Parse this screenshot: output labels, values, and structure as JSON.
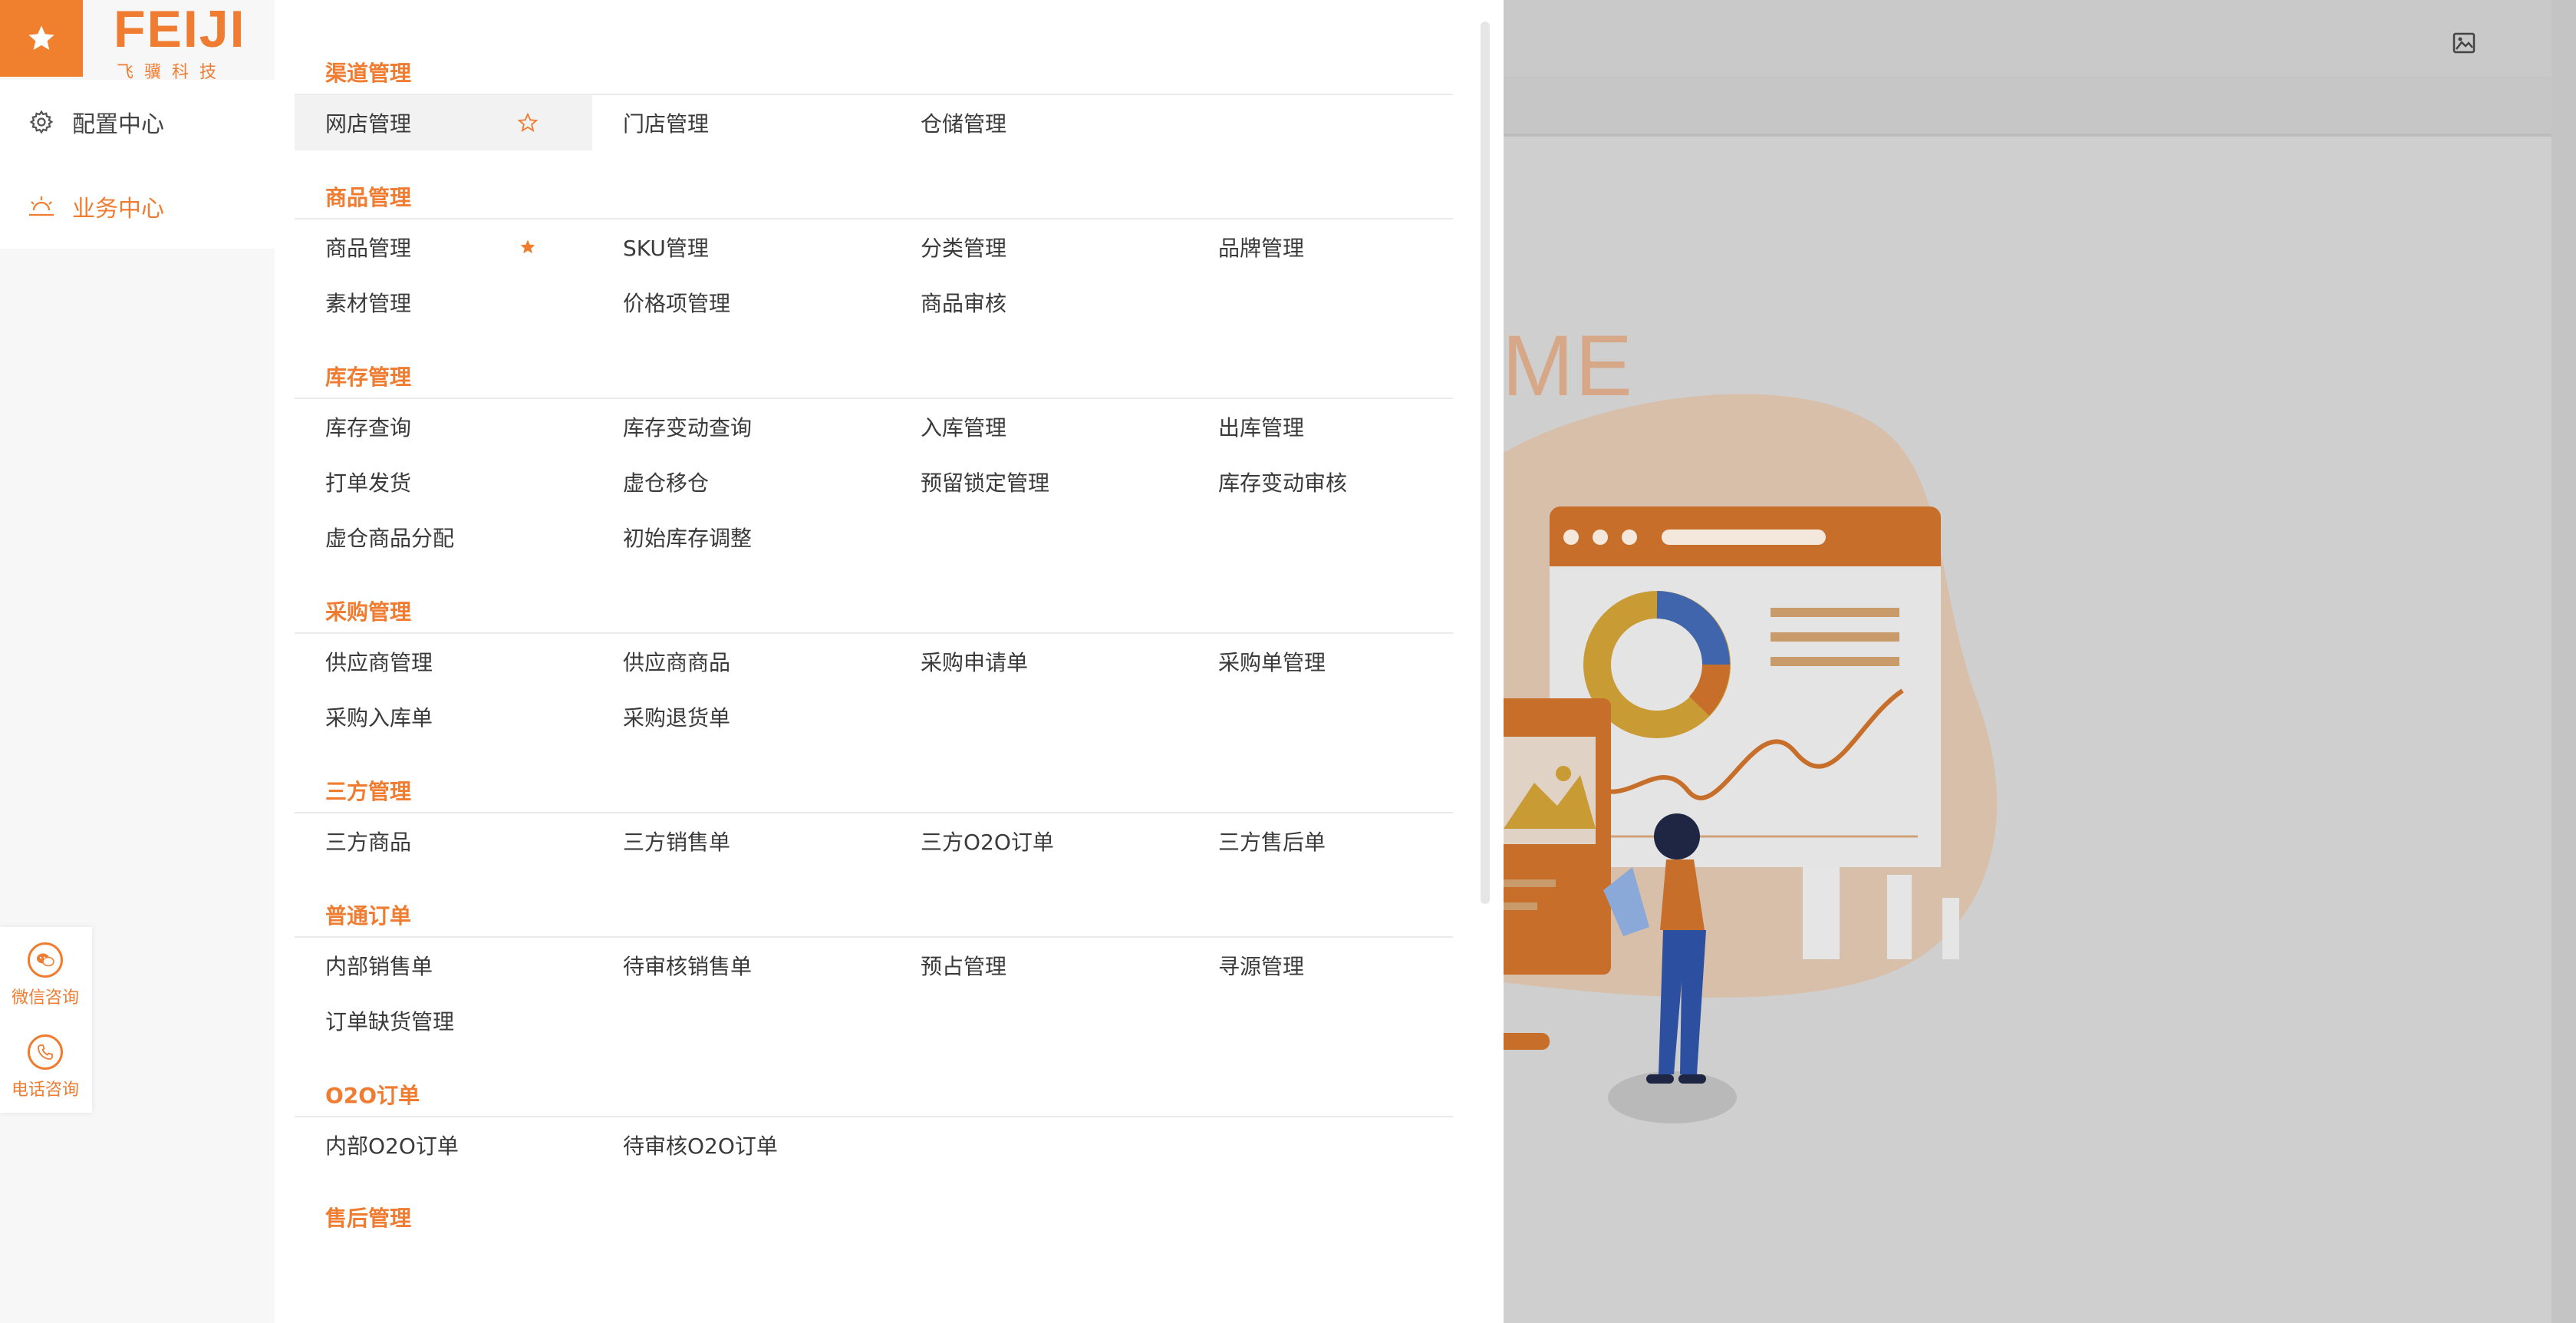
{
  "brand": {
    "word": "FEIJI",
    "sub": "飞骥科技"
  },
  "nav": {
    "config": "配置中心",
    "business": "业务中心"
  },
  "consult": {
    "wechat": "微信咨询",
    "phone": "电话咨询"
  },
  "background": {
    "welcome_text": "ME"
  },
  "colors": {
    "accent": "#ef7c30",
    "tile": "#f07f2e"
  },
  "menu": {
    "sections": [
      {
        "title": "渠道管理",
        "items": [
          "网店管理",
          "门店管理",
          "仓储管理"
        ]
      },
      {
        "title": "商品管理",
        "items": [
          "商品管理",
          "SKU管理",
          "分类管理",
          "品牌管理",
          "素材管理",
          "价格项管理",
          "商品审核"
        ]
      },
      {
        "title": "库存管理",
        "items": [
          "库存查询",
          "库存变动查询",
          "入库管理",
          "出库管理",
          "打单发货",
          "虚仓移仓",
          "预留锁定管理",
          "库存变动审核",
          "虚仓商品分配",
          "初始库存调整"
        ]
      },
      {
        "title": "采购管理",
        "items": [
          "供应商管理",
          "供应商商品",
          "采购申请单",
          "采购单管理",
          "采购入库单",
          "采购退货单"
        ]
      },
      {
        "title": "三方管理",
        "items": [
          "三方商品",
          "三方销售单",
          "三方O2O订单",
          "三方售后单"
        ]
      },
      {
        "title": "普通订单",
        "items": [
          "内部销售单",
          "待审核销售单",
          "预占管理",
          "寻源管理",
          "订单缺货管理"
        ]
      },
      {
        "title": "O2O订单",
        "items": [
          "内部O2O订单",
          "待审核O2O订单"
        ]
      },
      {
        "title": "售后管理",
        "items": []
      }
    ]
  }
}
